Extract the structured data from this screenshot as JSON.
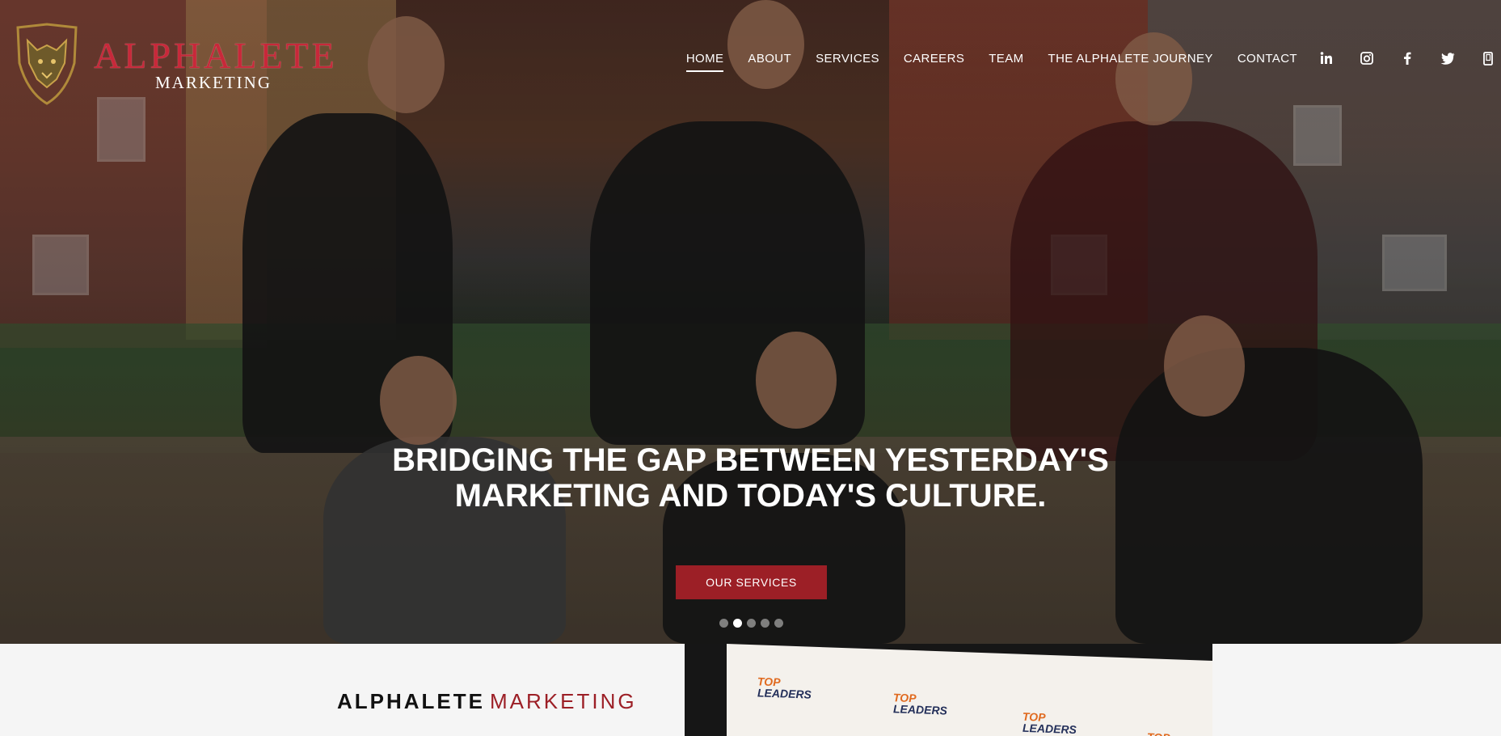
{
  "brand": {
    "name": "ALPHALETE",
    "subtitle": "MARKETING"
  },
  "nav": {
    "items": [
      {
        "label": "HOME",
        "active": true
      },
      {
        "label": "ABOUT",
        "active": false
      },
      {
        "label": "SERVICES",
        "active": false
      },
      {
        "label": "CAREERS",
        "active": false
      },
      {
        "label": "TEAM",
        "active": false
      },
      {
        "label": "THE ALPHALETE JOURNEY",
        "active": false
      },
      {
        "label": "CONTACT",
        "active": false
      }
    ],
    "social": [
      "linkedin-icon",
      "instagram-icon",
      "facebook-icon",
      "twitter-icon",
      "mobile-icon"
    ]
  },
  "hero": {
    "headline_line1": "BRIDGING THE GAP BETWEEN YESTERDAY'S",
    "headline_line2": "MARKETING AND TODAY'S CULTURE.",
    "cta_label": "OUR SERVICES",
    "slides_total": 5,
    "active_slide": 2
  },
  "section": {
    "title_black": "ALPHALETE",
    "title_red": "MARKETING"
  },
  "stage_banner": {
    "logo_top": "TOP",
    "logo_bottom": "LEADERS"
  },
  "colors": {
    "accent": "#9c1f26",
    "brand_red": "#c8283a",
    "gold": "#b08a3a",
    "white": "#ffffff"
  }
}
